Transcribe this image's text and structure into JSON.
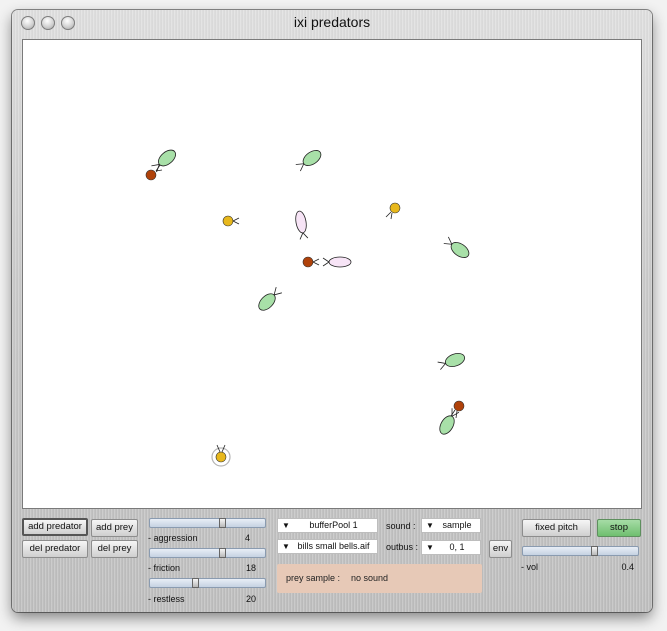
{
  "window": {
    "title": "ixi predators"
  },
  "buttons": {
    "add_predator": "add predator",
    "add_prey": "add prey",
    "del_predator": "del predator",
    "del_prey": "del prey",
    "env": "env",
    "fixed_pitch": "fixed pitch",
    "stop": "stop"
  },
  "sliders": {
    "aggression": {
      "label": "- aggression",
      "value": "4",
      "level": 0.6
    },
    "friction": {
      "label": "- friction",
      "value": "18",
      "level": 0.6
    },
    "restless": {
      "label": "- restless",
      "value": "20",
      "level": 0.37
    },
    "vol": {
      "label": "- vol",
      "value": "0.4",
      "level": 0.58
    }
  },
  "dropdowns": {
    "buffer_pool": "bufferPool 1",
    "sample_file": "bills small bells.aif",
    "sound": "sample",
    "outbus": "0, 1"
  },
  "labels": {
    "sound": "sound :",
    "outbus": "outbus :",
    "prey_sample": "prey sample :",
    "prey_sample_value": "no sound"
  },
  "colors": {
    "predator_green": "#a8e0a8",
    "prey_pink": "#f7e4f6",
    "red_dot": "#b0420a",
    "yellow_dot": "#e8b81c",
    "stop_green": "#7fc97f",
    "info_box": "#e7c9b7"
  }
}
